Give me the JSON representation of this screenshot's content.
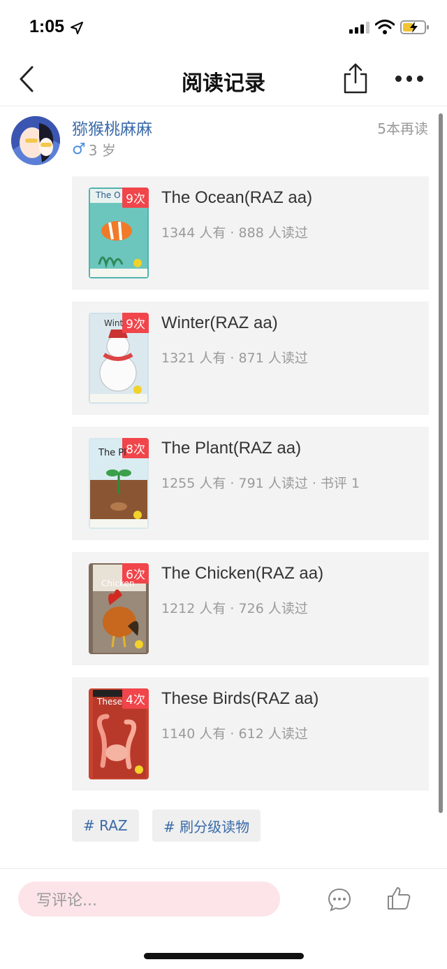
{
  "status_bar": {
    "time": "1:05"
  },
  "nav": {
    "title": "阅读记录"
  },
  "user": {
    "name": "猕猴桃麻麻",
    "gender_symbol": "♂",
    "age": "3 岁",
    "reread_count": "5本再读"
  },
  "books": [
    {
      "title": "The Ocean(RAZ aa)",
      "cover_text": "The O",
      "count": "9次",
      "stats": "1344 人有 · 888 人读过",
      "cover_bg": "#4fb3b0"
    },
    {
      "title": "Winter(RAZ aa)",
      "cover_text": "Wint",
      "count": "9次",
      "stats": "1321 人有 · 871 人读过",
      "cover_bg": "#cfe1ea"
    },
    {
      "title": "The Plant(RAZ aa)",
      "cover_text": "The Pl",
      "count": "8次",
      "stats": "1255 人有 · 791 人读过 · 书评 1",
      "cover_bg": "#d6e7ee"
    },
    {
      "title": "The Chicken(RAZ aa)",
      "cover_text": "Chicken",
      "count": "6次",
      "stats": "1212 人有 · 726 人读过",
      "cover_bg": "#7c6b5b"
    },
    {
      "title": "These Birds(RAZ aa)",
      "cover_text": "These",
      "count": "4次",
      "stats": "1140 人有 · 612 人读过",
      "cover_bg": "#c8432f"
    }
  ],
  "tags": [
    "# RAZ",
    "# 刷分级读物"
  ],
  "comment": {
    "placeholder": "写评论..."
  },
  "colors": {
    "accent_blue": "#3a6aa8",
    "badge_red": "#f0454a",
    "comment_bg": "#fde4e8"
  },
  "icons": [
    "back-icon",
    "share-icon",
    "more-icon",
    "comment-icon",
    "like-icon"
  ]
}
